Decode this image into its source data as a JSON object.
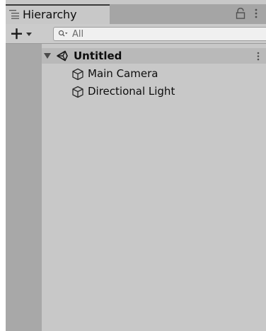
{
  "window": {
    "tab_label": "Hierarchy",
    "tab_icon": "hierarchy-list-icon",
    "lock_icon": "lock-icon",
    "menu_icon": "kebab-menu-icon"
  },
  "toolbar": {
    "add_icon": "plus-icon",
    "dropdown_icon": "dropdown-arrow-icon",
    "search": {
      "placeholder": "All",
      "icon": "search-icon"
    }
  },
  "hierarchy": {
    "scene": {
      "name": "Untitled",
      "expanded": true,
      "icon": "unity-logo-icon"
    },
    "objects": [
      {
        "name": "Main Camera",
        "icon": "cube-icon"
      },
      {
        "name": "Directional Light",
        "icon": "cube-icon"
      }
    ]
  },
  "colors": {
    "panel_bg": "#c8c8c8",
    "tab_strip_bg": "#a5a5a5",
    "gutter_bg": "#a8a8a8",
    "scene_row_bg": "#b9b9b9",
    "text": "#0d0d0d"
  }
}
